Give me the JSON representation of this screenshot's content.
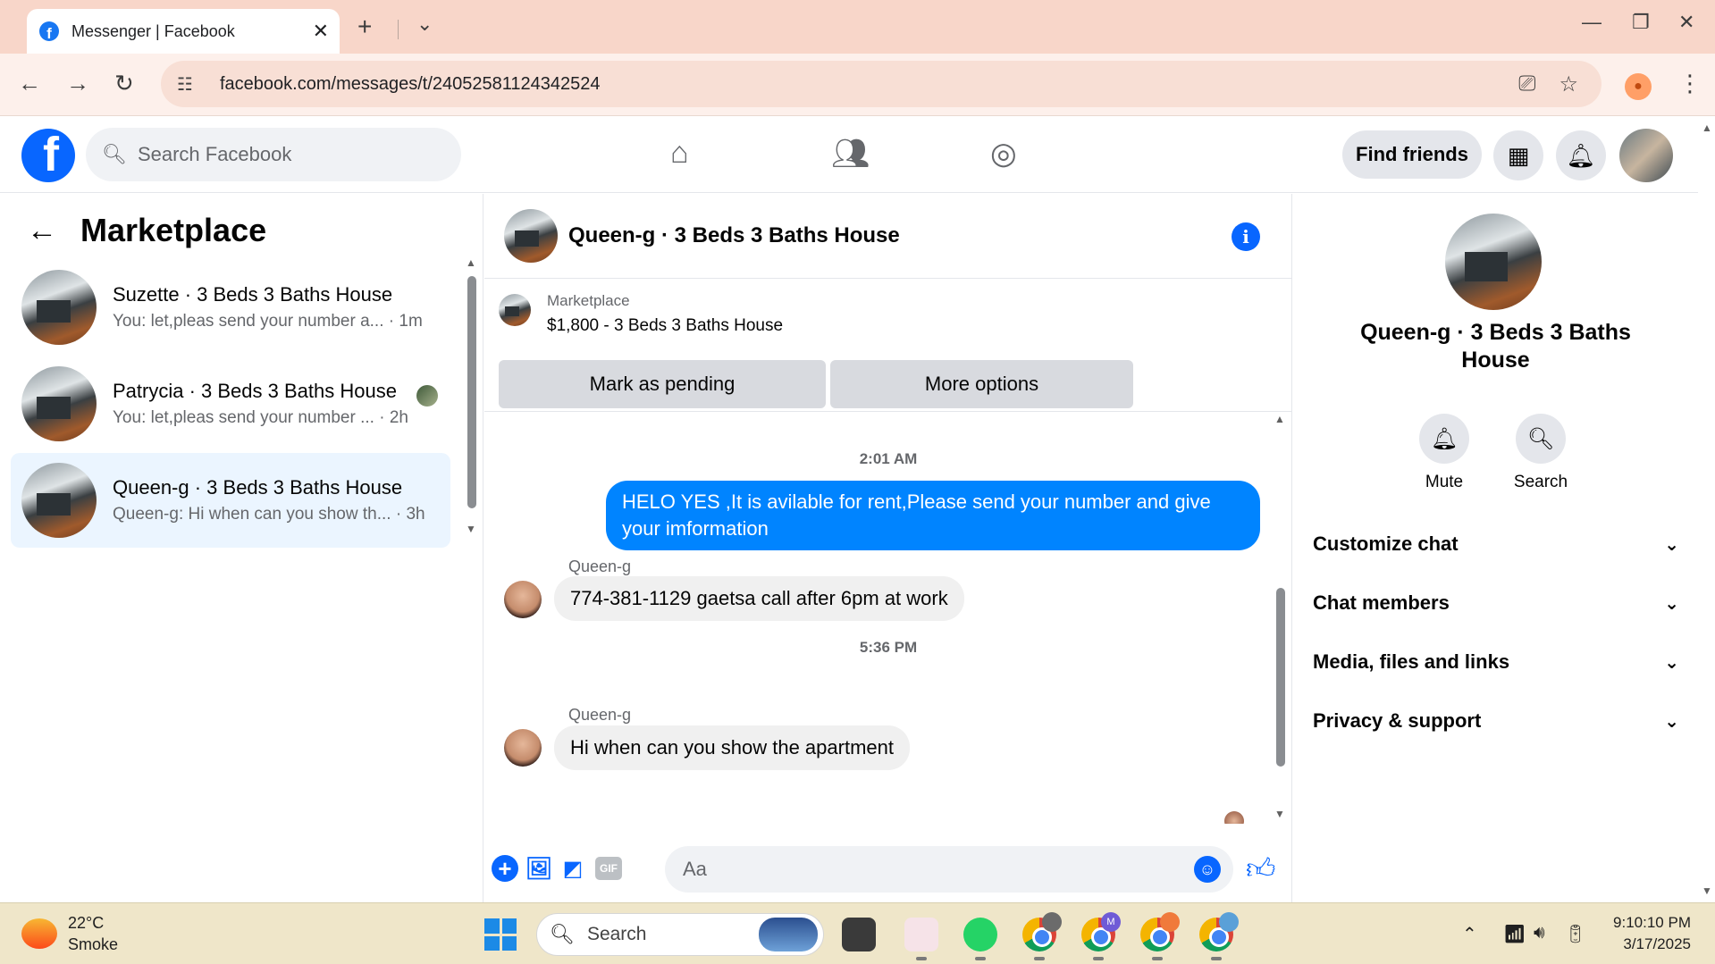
{
  "browser": {
    "tab_title": "Messenger | Facebook",
    "url": "facebook.com/messages/t/24052581124342524"
  },
  "fb_header": {
    "search_placeholder": "Search Facebook",
    "find_friends": "Find friends"
  },
  "left": {
    "title": "Marketplace",
    "conversations": [
      {
        "name": "Suzette · 3 Beds 3 Baths House",
        "preview": "You: let,pleas send your number a...",
        "time": "· 1m",
        "active": false
      },
      {
        "name": "Patrycia · 3 Beds 3 Baths House",
        "preview": "You: let,pleas send your number ...",
        "time": "· 2h",
        "active": false
      },
      {
        "name": "Queen-g · 3 Beds 3 Baths House",
        "preview": "Queen-g: Hi when can you show th...",
        "time": "· 3h",
        "active": true
      }
    ]
  },
  "chat": {
    "title": "Queen-g · 3 Beds 3 Baths House",
    "marketplace_label": "Marketplace",
    "listing": "$1,800 - 3 Beds 3 Baths House",
    "mark_pending": "Mark as pending",
    "more_options": "More options",
    "messages": [
      {
        "type": "time",
        "text": "2:01 AM"
      },
      {
        "type": "out",
        "text": "HELO YES ,It is avilable for rent,Please send your number and give your imformation"
      },
      {
        "type": "sender",
        "text": "Queen-g"
      },
      {
        "type": "in",
        "text": "774-381-1129 gaetsa call after 6pm at work"
      },
      {
        "type": "time",
        "text": "5:36 PM"
      },
      {
        "type": "sender",
        "text": "Queen-g"
      },
      {
        "type": "in",
        "text": "Hi when can you show the apartment"
      }
    ],
    "composer_placeholder": "Aa",
    "gif_label": "GIF"
  },
  "right": {
    "name": "Queen-g · 3 Beds 3 Baths House",
    "mute": "Mute",
    "search": "Search",
    "sections": [
      "Customize chat",
      "Chat members",
      "Media, files and links",
      "Privacy & support"
    ]
  },
  "taskbar": {
    "temp": "22°C",
    "weather": "Smoke",
    "search_placeholder": "Search",
    "time": "9:10:10 PM",
    "date": "3/17/2025",
    "chrome_badge_m": "M"
  }
}
